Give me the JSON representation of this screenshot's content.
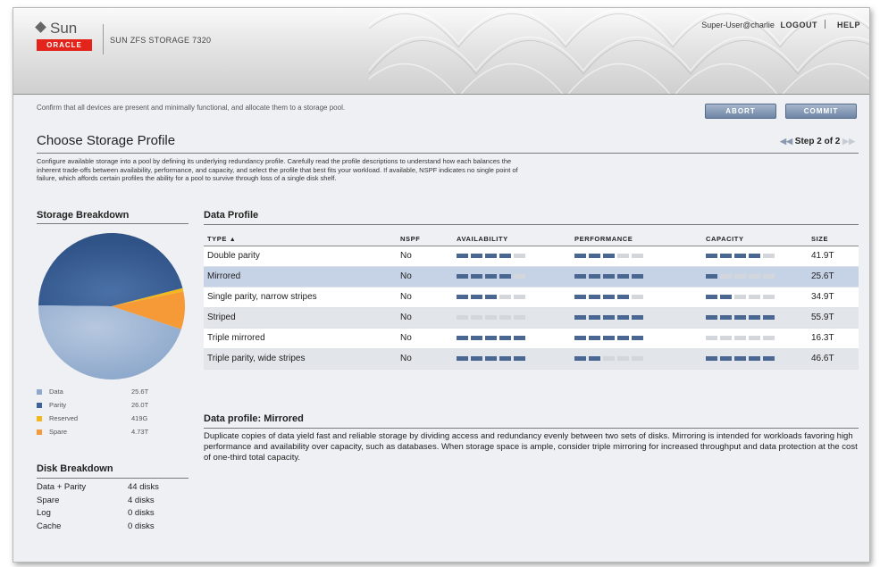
{
  "header": {
    "logo_sun": "Sun",
    "logo_oracle": "ORACLE",
    "product": "SUN ZFS STORAGE 7320",
    "user": "Super-User@charlie",
    "logout": "LOGOUT",
    "help": "HELP"
  },
  "instruction": "Confirm that all devices are present and minimally functional, and allocate them to a storage pool.",
  "buttons": {
    "abort": "ABORT",
    "commit": "COMMIT"
  },
  "page_title": "Choose Storage Profile",
  "step": "Step 2 of 2",
  "description": "Configure available storage into a pool by defining its underlying redundancy profile. Carefully read the profile descriptions to understand how each balances the inherent trade-offs between availability, performance, and capacity, and select the profile that best fits your workload. If available, NSPF indicates no single point of failure, which affords certain profiles the ability for a pool to survive through loss of a single disk shelf.",
  "storage_breakdown": {
    "title": "Storage Breakdown",
    "colors": {
      "data": "#8ea9cc",
      "parity": "#3d6399",
      "reserved": "#f3b91c",
      "spare": "#f59a37"
    },
    "legend": [
      {
        "label": "Data",
        "value": "25.6T",
        "color": "#8ea9cc"
      },
      {
        "label": "Parity",
        "value": "26.0T",
        "color": "#3d6399"
      },
      {
        "label": "Reserved",
        "value": "419G",
        "color": "#f3b91c"
      },
      {
        "label": "Spare",
        "value": "4.73T",
        "color": "#f59a37"
      }
    ]
  },
  "disk_breakdown": {
    "title": "Disk Breakdown",
    "rows": [
      {
        "label": "Data + Parity",
        "value": "44 disks"
      },
      {
        "label": "Spare",
        "value": "4 disks"
      },
      {
        "label": "Log",
        "value": "0 disks"
      },
      {
        "label": "Cache",
        "value": "0 disks"
      }
    ]
  },
  "data_profile": {
    "title": "Data Profile",
    "columns": {
      "type": "TYPE",
      "sort": "▲",
      "nspf": "NSPF",
      "availability": "AVAILABILITY",
      "performance": "PERFORMANCE",
      "capacity": "CAPACITY",
      "size": "SIZE"
    },
    "rows": [
      {
        "type": "Double parity",
        "nspf": "No",
        "availability": 4,
        "performance": 3,
        "capacity": 4,
        "size": "41.9T"
      },
      {
        "type": "Mirrored",
        "nspf": "No",
        "availability": 4,
        "performance": 5,
        "capacity": 1,
        "size": "25.6T",
        "selected": true
      },
      {
        "type": "Single parity, narrow stripes",
        "nspf": "No",
        "availability": 3,
        "performance": 4,
        "capacity": 2,
        "size": "34.9T"
      },
      {
        "type": "Striped",
        "nspf": "No",
        "availability": 0,
        "performance": 5,
        "capacity": 5,
        "size": "55.9T"
      },
      {
        "type": "Triple mirrored",
        "nspf": "No",
        "availability": 5,
        "performance": 5,
        "capacity": 0,
        "size": "16.3T"
      },
      {
        "type": "Triple parity, wide stripes",
        "nspf": "No",
        "availability": 5,
        "performance": 2,
        "capacity": 5,
        "size": "46.6T"
      }
    ]
  },
  "profile_detail": {
    "title": "Data profile: Mirrored",
    "text": "Duplicate copies of data yield fast and reliable storage by dividing access and redundancy evenly between two sets of disks. Mirroring is intended for workloads favoring high performance and availability over capacity, such as databases. When storage space is ample, consider triple mirroring for increased throughput and data protection at the cost of one-third total capacity."
  }
}
